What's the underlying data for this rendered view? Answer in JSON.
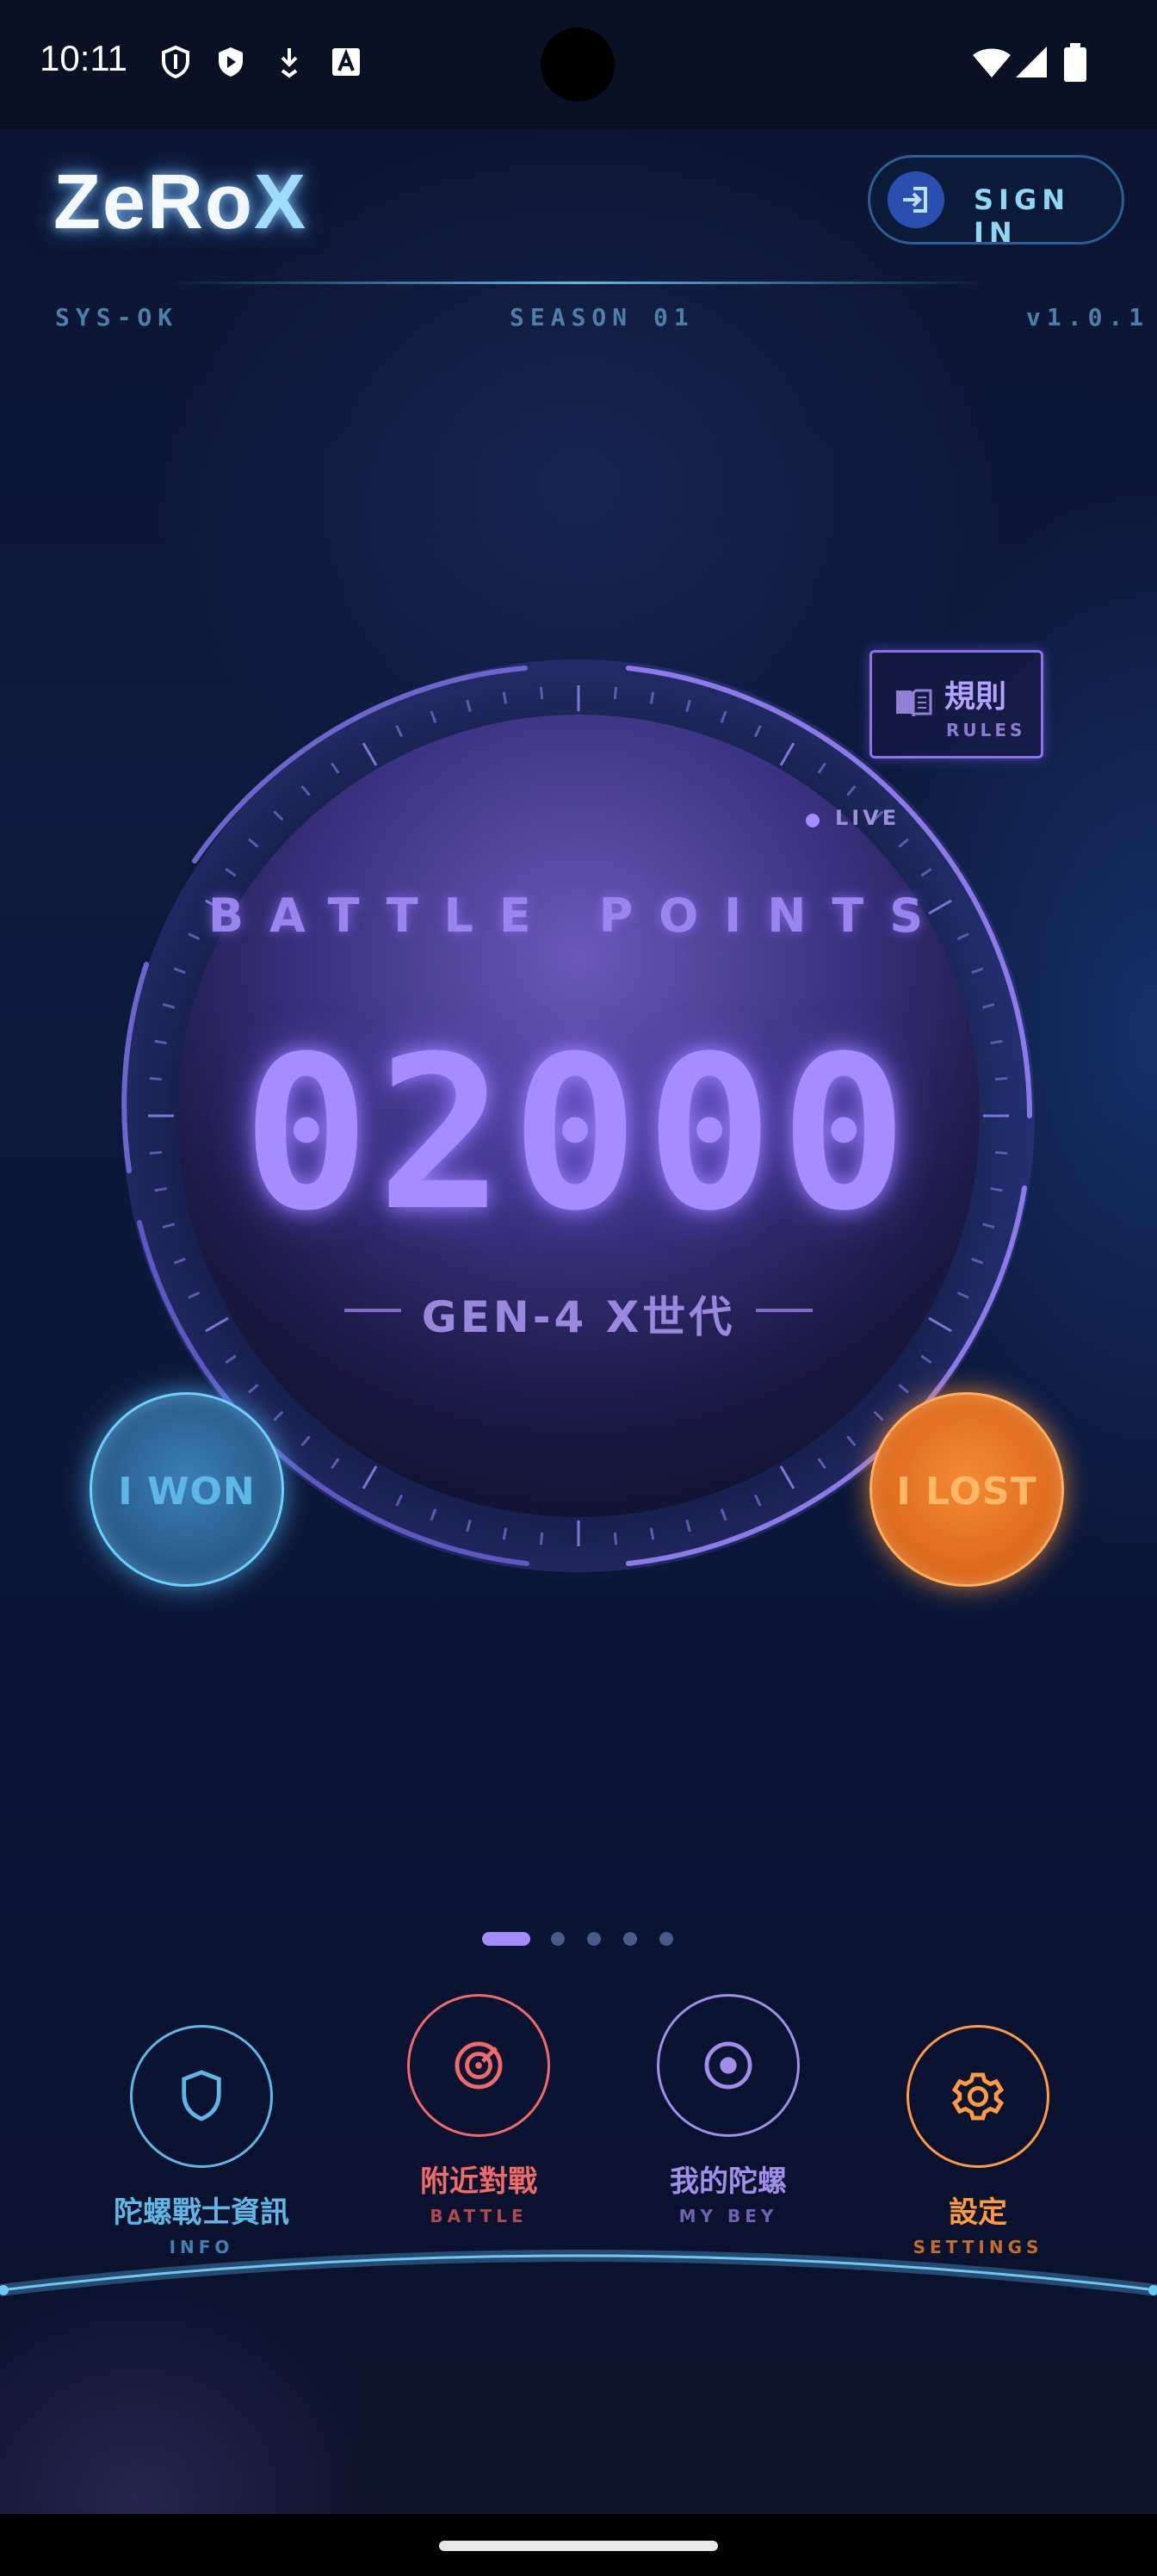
{
  "status_bar": {
    "time": "10:11",
    "left_icons": [
      "shield-outline-icon",
      "shield-play-icon",
      "download-icon",
      "font-a-icon"
    ],
    "right_icons": [
      "wifi-icon",
      "cell-signal-icon",
      "battery-icon"
    ]
  },
  "header": {
    "logo_main": "ZeRo",
    "logo_x": "X",
    "sign_in_label": "SIGN IN",
    "sign_in_icon": "login-icon",
    "status_left": "SYS-OK",
    "status_center": "SEASON 01",
    "status_right": "v1.0.1"
  },
  "rules": {
    "label": "規則",
    "sublabel": "RULES",
    "icon": "book-icon"
  },
  "battle": {
    "live_label": "LIVE",
    "title": "BATTLE POINTS",
    "points": "02000",
    "generation": "GEN-4 X世代"
  },
  "actions": {
    "won_label": "I WON",
    "lost_label": "I LOST"
  },
  "pager": {
    "count": 5,
    "active_index": 0
  },
  "nav": [
    {
      "label": "陀螺戰士資訊",
      "sub": "INFO",
      "icon": "shield-icon",
      "color": "#5fb7e6"
    },
    {
      "label": "附近對戰",
      "sub": "BATTLE",
      "icon": "target-icon",
      "color": "#f06a6a"
    },
    {
      "label": "我的陀螺",
      "sub": "MY BEY",
      "icon": "spinner-dot-icon",
      "color": "#a08ee8"
    },
    {
      "label": "設定",
      "sub": "SETTINGS",
      "icon": "gear-icon",
      "color": "#ff9a3d"
    }
  ],
  "colors": {
    "accent_blue": "#5fb7e6",
    "accent_purple": "#a58cff",
    "accent_orange": "#ff9a3d",
    "accent_red": "#f06a6a"
  }
}
